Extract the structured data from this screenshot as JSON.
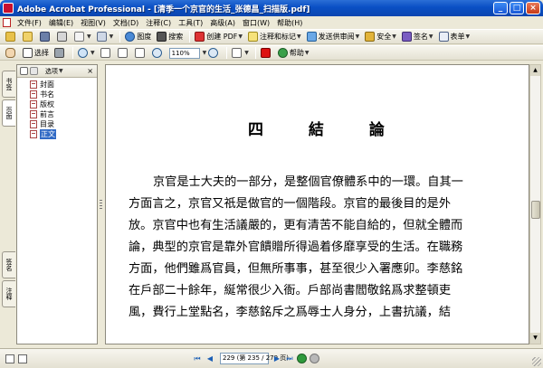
{
  "window": {
    "title": "Adobe Acrobat Professional - [清季一个京官的生活_张德昌_扫描版.pdf]",
    "minimize": "_",
    "maximize": "□",
    "close": "×"
  },
  "menubar": {
    "items": [
      "文件(F)",
      "编辑(E)",
      "视图(V)",
      "文档(D)",
      "注释(C)",
      "工具(T)",
      "高级(A)",
      "窗口(W)",
      "帮助(H)"
    ]
  },
  "toolbar1": {
    "search_label": "搜索",
    "create_pdf_label": "创建 PDF",
    "comment_label": "注释和标记",
    "review_label": "发送供审阅",
    "security_label": "安全",
    "sign_label": "签名",
    "forms_label": "表单"
  },
  "toolbar2": {
    "select_label": "选择",
    "zoom_value": "110%",
    "help_label": "帮助"
  },
  "sidebar": {
    "tabs": [
      "书签",
      "页面",
      "签名",
      "注释"
    ],
    "options_label": "选项",
    "close_label": "×",
    "bookmarks": [
      "封面",
      "书名",
      "版权",
      "前言",
      "目录",
      "正文"
    ],
    "selected_index": 5
  },
  "document": {
    "heading": "四 結 論",
    "lines": [
      "京官是士大夫的一部分，是整個官僚體系中的一環。自其一",
      "方面言之，京官又祇是做官的一個階段。京官的最後目的是外",
      "放。京官中也有生活議嚴的，更有清苦不能自給的，但就全體而",
      "論，典型的京官是靠外官饋贈所得過着侈靡享受的生活。在職務",
      "方面，他們雖爲官員，但無所事事，甚至很少入署應卯。李慈銘",
      "在戶部二十餘年，綖常很少入衙。戶部尚書閻敬銘爲求整頓吏",
      "風，費行上堂點名，李慈銘斥之爲辱士人身分，上書抗議，結"
    ]
  },
  "statusbar": {
    "page_display": "229 (第 235 / 279 页)",
    "first": "⏮",
    "prev": "◀",
    "next": "▶",
    "last": "⏭"
  },
  "colors": {
    "titlebar": "#0a4fc4",
    "selection": "#316ac5",
    "acrobat_red": "#c8102e"
  }
}
